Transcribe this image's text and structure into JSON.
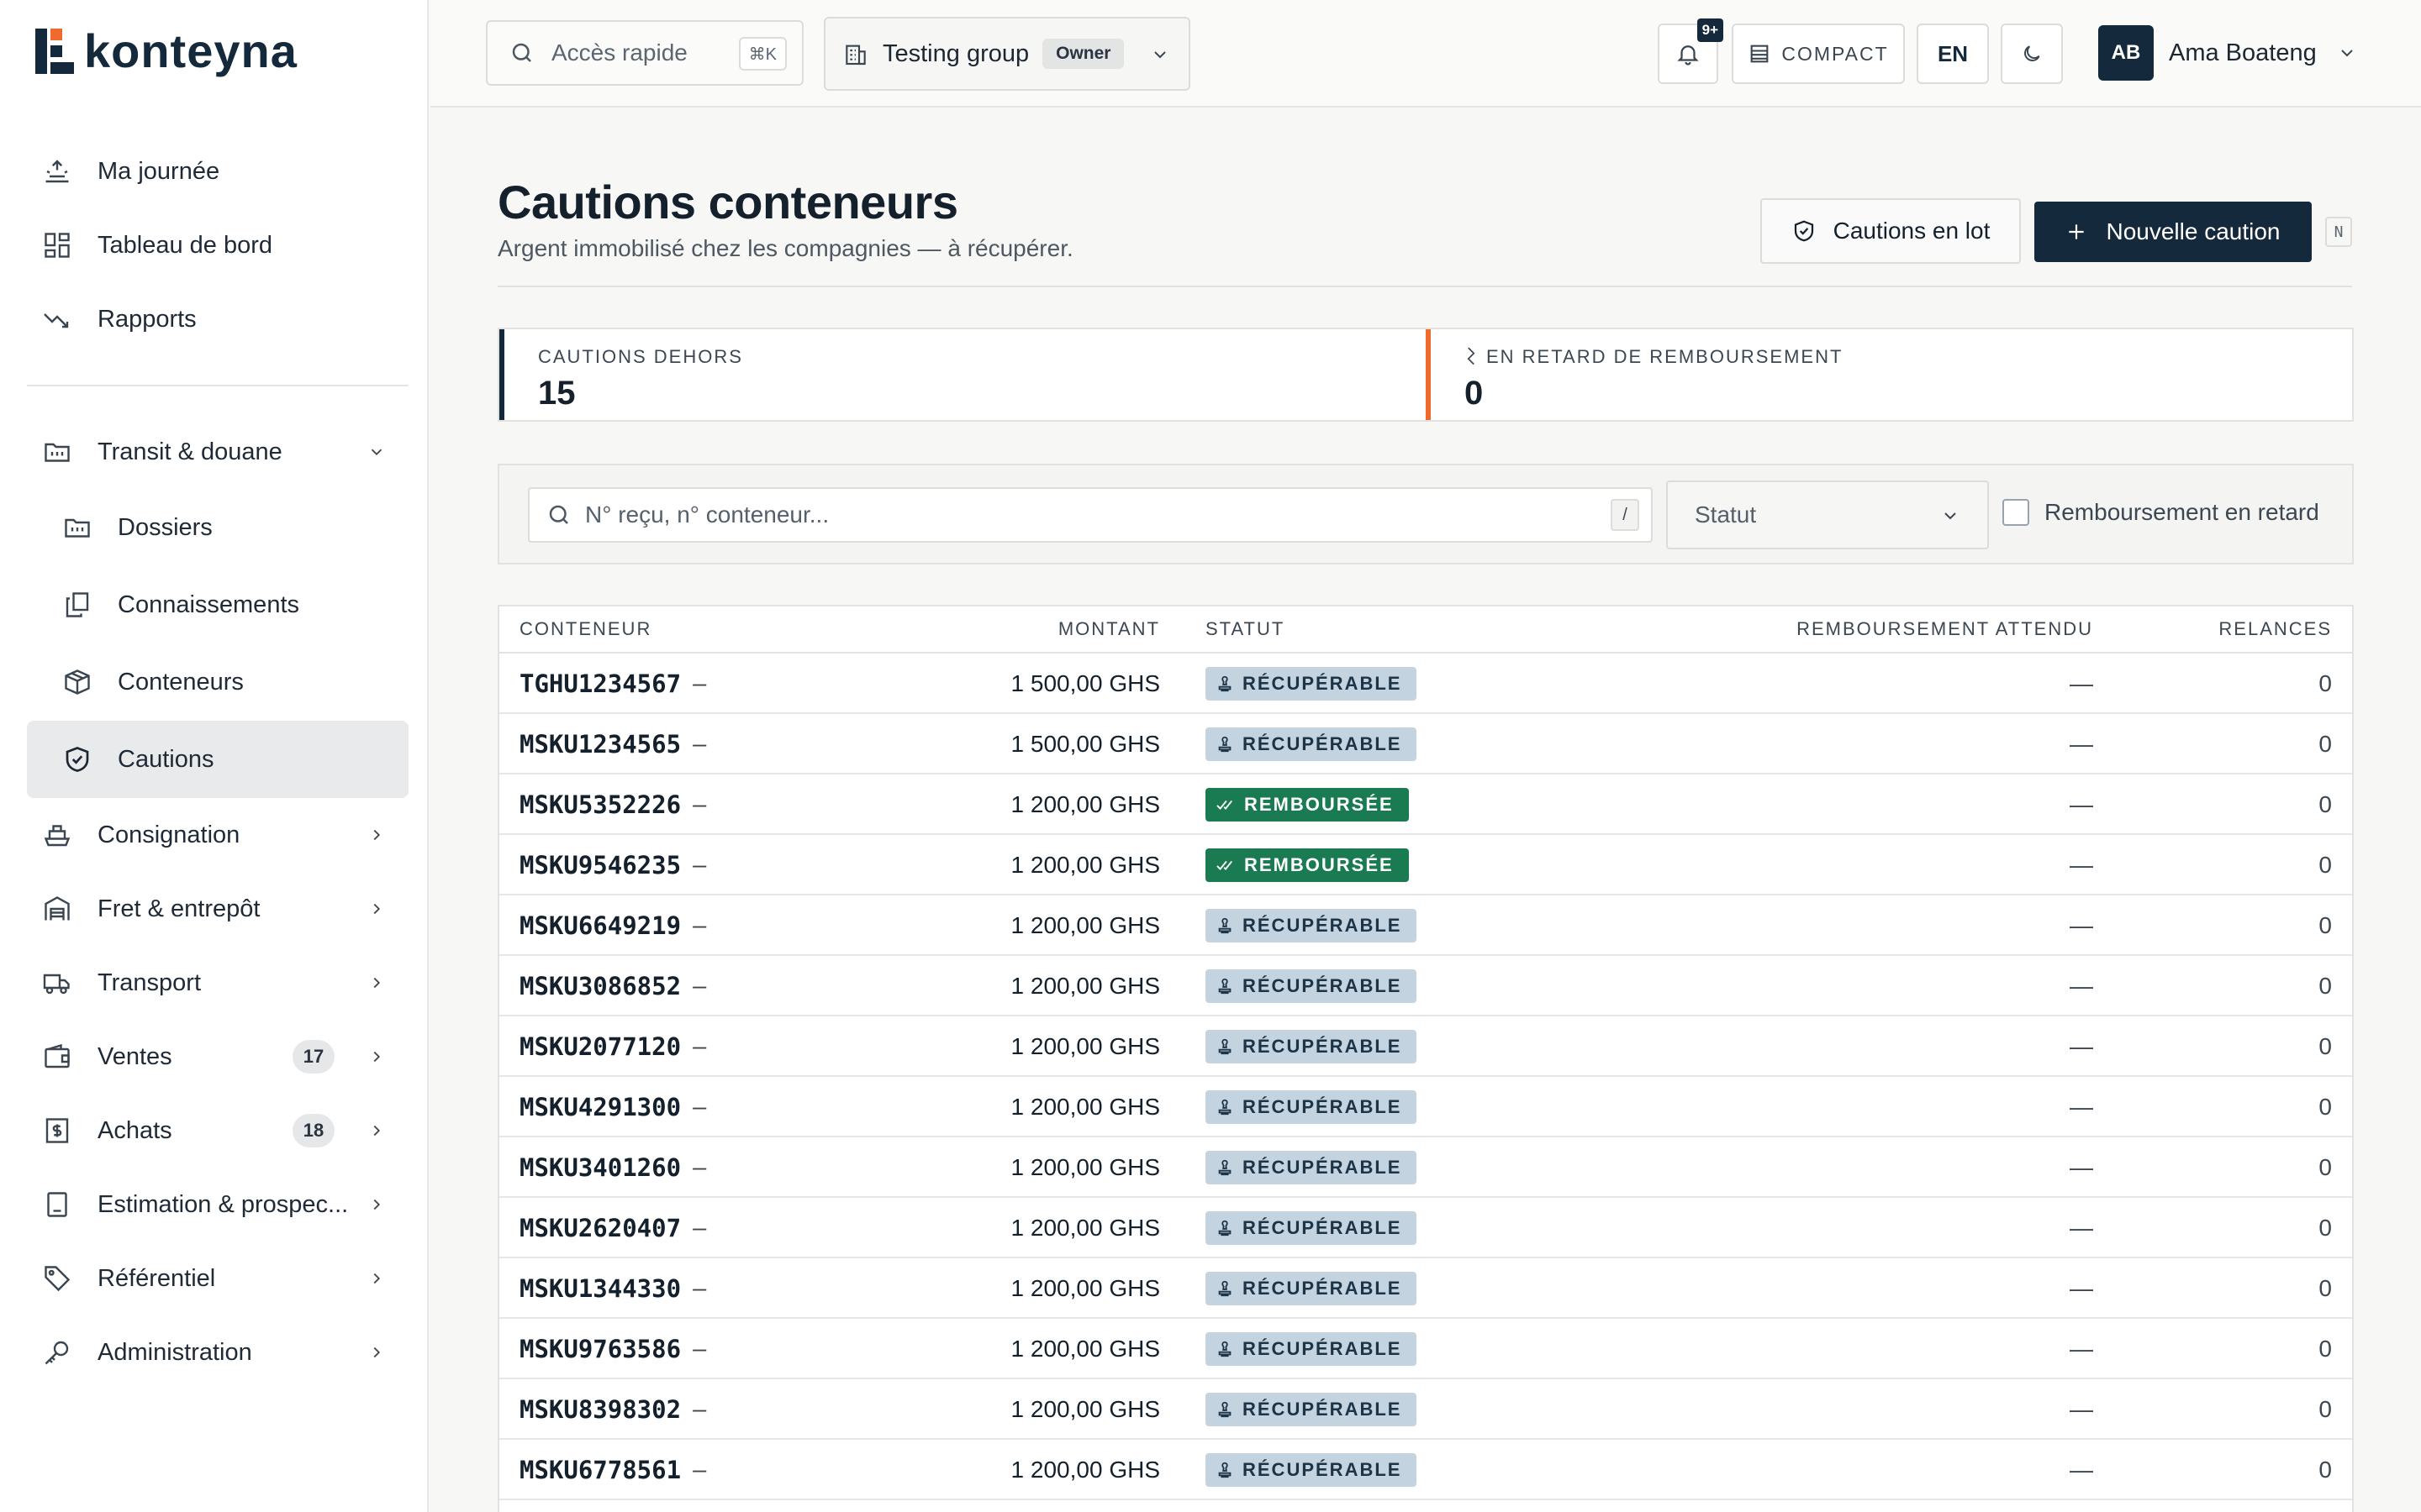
{
  "app": {
    "logo_text": "konteyna",
    "brand_color": "#14293b",
    "accent_color": "#ef6a2c"
  },
  "sidebar": {
    "top_items": [
      {
        "label": "Ma journée",
        "icon": "sun-horizon-icon"
      },
      {
        "label": "Tableau de bord",
        "icon": "dashboard-grid-icon"
      },
      {
        "label": "Rapports",
        "icon": "trend-down-icon"
      }
    ],
    "groups": [
      {
        "label": "Transit & douane",
        "icon": "folder-icon",
        "expanded": true,
        "children": [
          {
            "label": "Dossiers",
            "icon": "folder-icon"
          },
          {
            "label": "Connaissements",
            "icon": "documents-icon"
          },
          {
            "label": "Conteneurs",
            "icon": "box-icon"
          },
          {
            "label": "Cautions",
            "icon": "shield-icon",
            "active": true
          }
        ]
      },
      {
        "label": "Consignation",
        "icon": "ship-icon"
      },
      {
        "label": "Fret & entrepôt",
        "icon": "warehouse-icon"
      },
      {
        "label": "Transport",
        "icon": "truck-icon"
      },
      {
        "label": "Ventes",
        "icon": "wallet-icon",
        "badge": "17"
      },
      {
        "label": "Achats",
        "icon": "dollar-doc-icon",
        "badge": "18"
      },
      {
        "label": "Estimation & prospec...",
        "icon": "calculator-icon"
      },
      {
        "label": "Référentiel",
        "icon": "tag-icon"
      },
      {
        "label": "Administration",
        "icon": "key-icon"
      }
    ]
  },
  "topbar": {
    "quick_access": {
      "placeholder": "Accès rapide",
      "shortcut": "⌘K"
    },
    "group": {
      "name": "Testing group",
      "role": "Owner"
    },
    "notifications_badge": "9+",
    "compact_label": "COMPACT",
    "lang_label": "EN",
    "user": {
      "initials": "AB",
      "name": "Ama Boateng"
    }
  },
  "page": {
    "title": "Cautions conteneurs",
    "subtitle": "Argent immobilisé chez les compagnies — à récupérer.",
    "btn_lot": "Cautions en lot",
    "btn_new": "Nouvelle caution",
    "btn_new_shortcut": "N"
  },
  "stats": [
    {
      "label": "CAUTIONS DEHORS",
      "value": "15"
    },
    {
      "label": "EN RETARD DE REMBOURSEMENT",
      "value": "0"
    }
  ],
  "filters": {
    "search_placeholder": "N° reçu, n° conteneur...",
    "search_shortcut": "/",
    "status_placeholder": "Statut",
    "late_label": "Remboursement en retard"
  },
  "table": {
    "headers": {
      "container": "CONTENEUR",
      "amount": "MONTANT",
      "status": "STATUT",
      "expected": "REMBOURSEMENT ATTENDU",
      "reminders": "RELANCES"
    },
    "rows": [
      {
        "container": "TGHU1234567",
        "dash": "–",
        "amount": "1 500,00 GHS",
        "status": "RÉCUPÉRABLE",
        "status_kind": "recup",
        "expected": "—",
        "reminders": "0"
      },
      {
        "container": "MSKU1234565",
        "dash": "–",
        "amount": "1 500,00 GHS",
        "status": "RÉCUPÉRABLE",
        "status_kind": "recup",
        "expected": "—",
        "reminders": "0"
      },
      {
        "container": "MSKU5352226",
        "dash": "–",
        "amount": "1 200,00 GHS",
        "status": "REMBOURSÉE",
        "status_kind": "remb",
        "expected": "—",
        "reminders": "0"
      },
      {
        "container": "MSKU9546235",
        "dash": "–",
        "amount": "1 200,00 GHS",
        "status": "REMBOURSÉE",
        "status_kind": "remb",
        "expected": "—",
        "reminders": "0"
      },
      {
        "container": "MSKU6649219",
        "dash": "–",
        "amount": "1 200,00 GHS",
        "status": "RÉCUPÉRABLE",
        "status_kind": "recup",
        "expected": "—",
        "reminders": "0"
      },
      {
        "container": "MSKU3086852",
        "dash": "–",
        "amount": "1 200,00 GHS",
        "status": "RÉCUPÉRABLE",
        "status_kind": "recup",
        "expected": "—",
        "reminders": "0"
      },
      {
        "container": "MSKU2077120",
        "dash": "–",
        "amount": "1 200,00 GHS",
        "status": "RÉCUPÉRABLE",
        "status_kind": "recup",
        "expected": "—",
        "reminders": "0"
      },
      {
        "container": "MSKU4291300",
        "dash": "–",
        "amount": "1 200,00 GHS",
        "status": "RÉCUPÉRABLE",
        "status_kind": "recup",
        "expected": "—",
        "reminders": "0"
      },
      {
        "container": "MSKU3401260",
        "dash": "–",
        "amount": "1 200,00 GHS",
        "status": "RÉCUPÉRABLE",
        "status_kind": "recup",
        "expected": "—",
        "reminders": "0"
      },
      {
        "container": "MSKU2620407",
        "dash": "–",
        "amount": "1 200,00 GHS",
        "status": "RÉCUPÉRABLE",
        "status_kind": "recup",
        "expected": "—",
        "reminders": "0"
      },
      {
        "container": "MSKU1344330",
        "dash": "–",
        "amount": "1 200,00 GHS",
        "status": "RÉCUPÉRABLE",
        "status_kind": "recup",
        "expected": "—",
        "reminders": "0"
      },
      {
        "container": "MSKU9763586",
        "dash": "–",
        "amount": "1 200,00 GHS",
        "status": "RÉCUPÉRABLE",
        "status_kind": "recup",
        "expected": "—",
        "reminders": "0"
      },
      {
        "container": "MSKU8398302",
        "dash": "–",
        "amount": "1 200,00 GHS",
        "status": "RÉCUPÉRABLE",
        "status_kind": "recup",
        "expected": "—",
        "reminders": "0"
      },
      {
        "container": "MSKU6778561",
        "dash": "–",
        "amount": "1 200,00 GHS",
        "status": "RÉCUPÉRABLE",
        "status_kind": "recup",
        "expected": "—",
        "reminders": "0"
      }
    ]
  }
}
